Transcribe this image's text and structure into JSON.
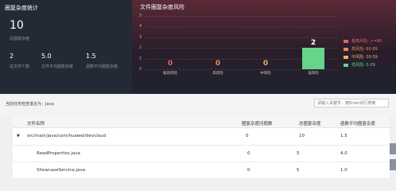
{
  "summary": {
    "title": "圈复杂度统计",
    "total_value": "10",
    "total_label": "总圈复杂度",
    "stats": [
      {
        "value": "2",
        "label": "总文件个数"
      },
      {
        "value": "5.0",
        "label": "文件平均圈复杂度"
      },
      {
        "value": "1.5",
        "label": "函数平均圈复杂度"
      }
    ]
  },
  "risk_chart": {
    "title": "文件圈复杂度风险"
  },
  "chart_data": {
    "type": "bar",
    "categories": [
      "极高风险",
      "高风险",
      "中风险",
      "低风险"
    ],
    "values": [
      0,
      0,
      0,
      2
    ],
    "ylim": [
      0,
      5
    ],
    "yticks": [
      "0",
      "1",
      "2",
      "3",
      "4",
      "5"
    ],
    "legend": [
      {
        "label": "极高风险: >=90",
        "color": "#e5675c"
      },
      {
        "label": "高风险: 60-89",
        "color": "#e98a5a"
      },
      {
        "label": "中风险: 30-59",
        "color": "#e9b25a"
      },
      {
        "label": "低风险: 0-29",
        "color": "#67d48c"
      }
    ],
    "label_colors": [
      "#e5675c",
      "#e98a5a",
      "#e9b25a",
      "#ffffff"
    ]
  },
  "filter": {
    "current_task_label": "当前任务检查语言为：Java",
    "search_placeholder": "请输入关键字，按Enter进行搜索"
  },
  "table": {
    "columns": [
      "文件名称",
      "圈复杂度问题数",
      "总圈复杂度",
      "函数平均圈复杂度"
    ],
    "rows": [
      {
        "name": "src/main/java/com/huawei/devcloud",
        "issues": "0",
        "total": "10",
        "avg": "1.5"
      },
      {
        "name": "ReadProperties.java",
        "issues": "0",
        "total": "5",
        "avg": "4.0"
      },
      {
        "name": "ShowcaseService.java",
        "issues": "0",
        "total": "5",
        "avg": "1.0"
      }
    ]
  },
  "expand_icon": "caret-down-icon"
}
